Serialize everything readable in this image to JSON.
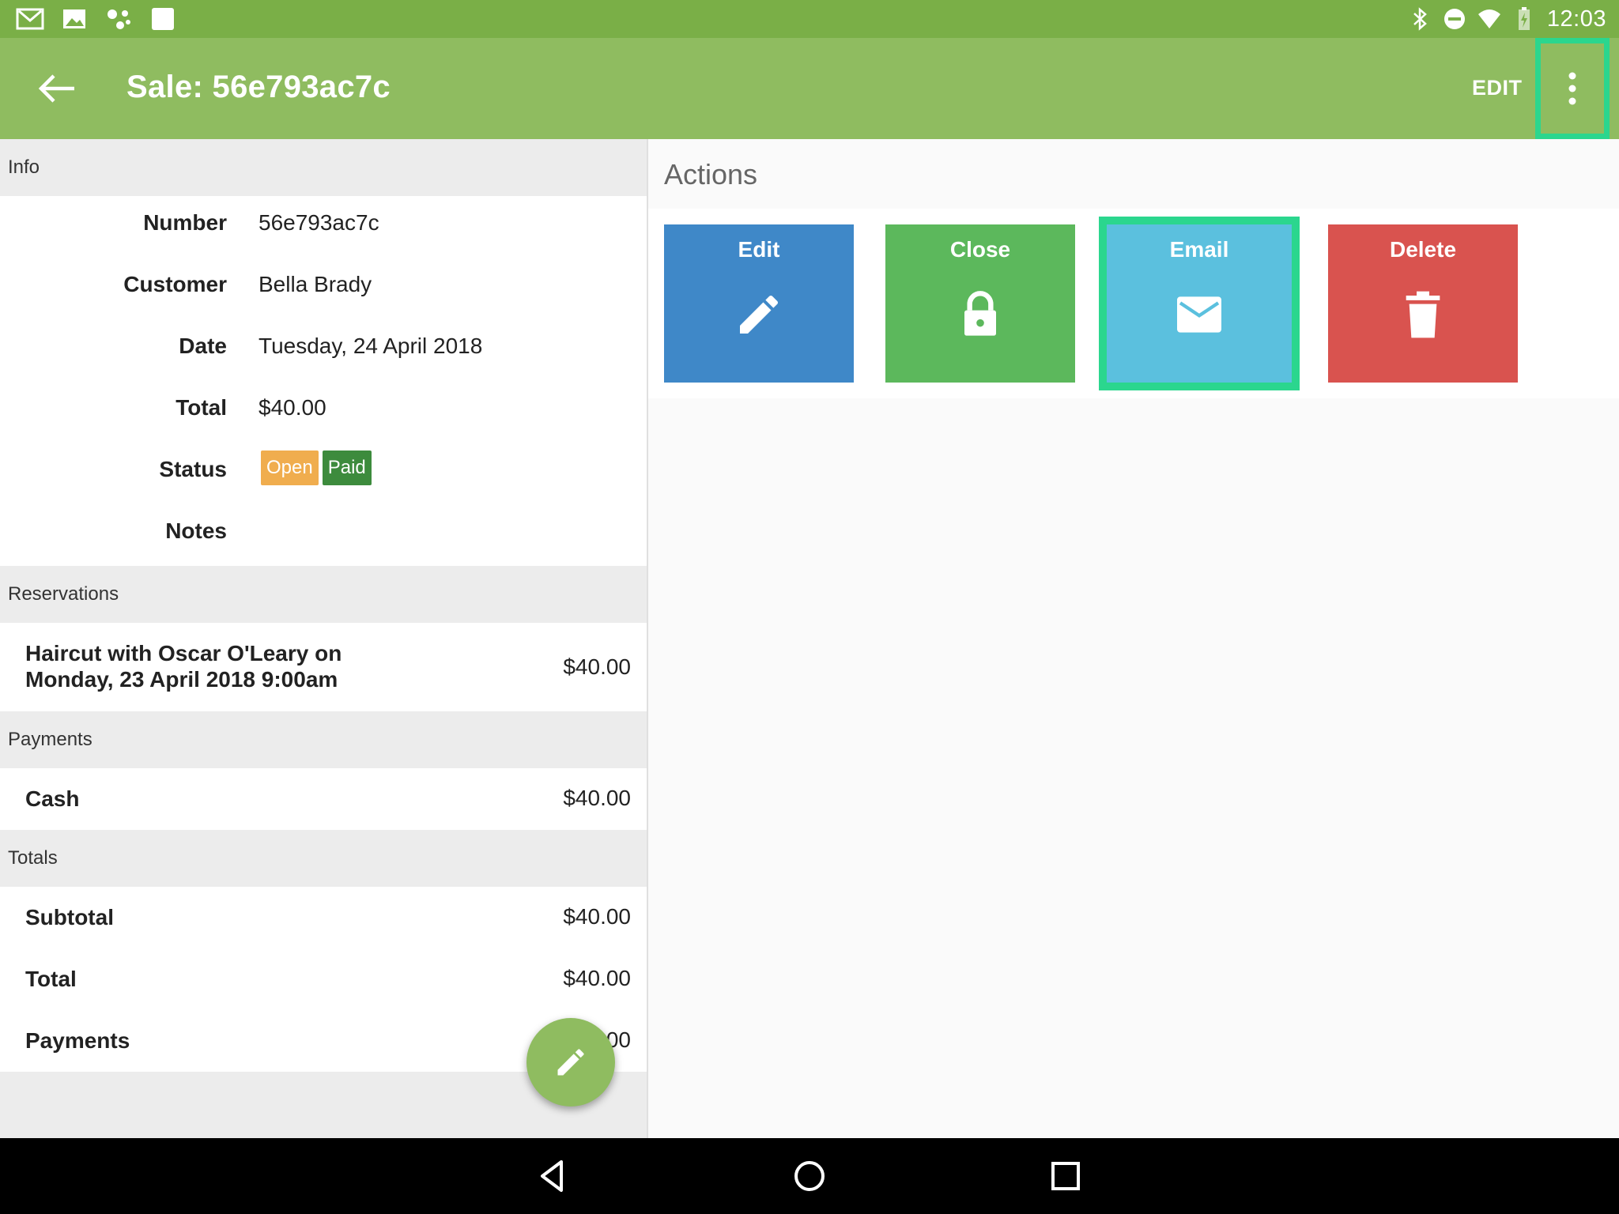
{
  "status_bar": {
    "time": "12:03",
    "left_icons": [
      "gmail-icon",
      "gallery-icon",
      "assistant-icon",
      "square-app-icon"
    ],
    "right_icons": [
      "bluetooth-icon",
      "do-not-disturb-icon",
      "wifi-icon",
      "battery-charging-icon"
    ]
  },
  "app_bar": {
    "title": "Sale: 56e793ac7c",
    "edit_label": "EDIT",
    "background": "#8fbc60"
  },
  "info": {
    "header": "Info",
    "rows": {
      "number": {
        "label": "Number",
        "value": "56e793ac7c"
      },
      "customer": {
        "label": "Customer",
        "value": "Bella Brady"
      },
      "date": {
        "label": "Date",
        "value": "Tuesday, 24 April 2018"
      },
      "total": {
        "label": "Total",
        "value": "$40.00"
      },
      "status": {
        "label": "Status",
        "badges": [
          "Open",
          "Paid"
        ]
      },
      "notes": {
        "label": "Notes",
        "value": ""
      }
    }
  },
  "reservations": {
    "header": "Reservations",
    "items": [
      {
        "line1": "Haircut with Oscar O'Leary on",
        "line2": "Monday, 23 April 2018 9:00am",
        "amount": "$40.00"
      }
    ]
  },
  "payments": {
    "header": "Payments",
    "items": [
      {
        "label": "Cash",
        "amount": "$40.00"
      }
    ]
  },
  "totals": {
    "header": "Totals",
    "items": [
      {
        "label": "Subtotal",
        "amount": "$40.00"
      },
      {
        "label": "Total",
        "amount": "$40.00"
      },
      {
        "label": "Payments",
        "amount": "$40.00"
      }
    ]
  },
  "actions": {
    "title": "Actions",
    "tiles": [
      {
        "label": "Edit",
        "icon": "pencil-icon",
        "color": "#3f88c8"
      },
      {
        "label": "Close",
        "icon": "lock-icon",
        "color": "#5cb85c"
      },
      {
        "label": "Email",
        "icon": "envelope-icon",
        "color": "#5bc0de"
      },
      {
        "label": "Delete",
        "icon": "trash-icon",
        "color": "#d9534f"
      }
    ]
  },
  "highlight_color": "#2bd68e"
}
